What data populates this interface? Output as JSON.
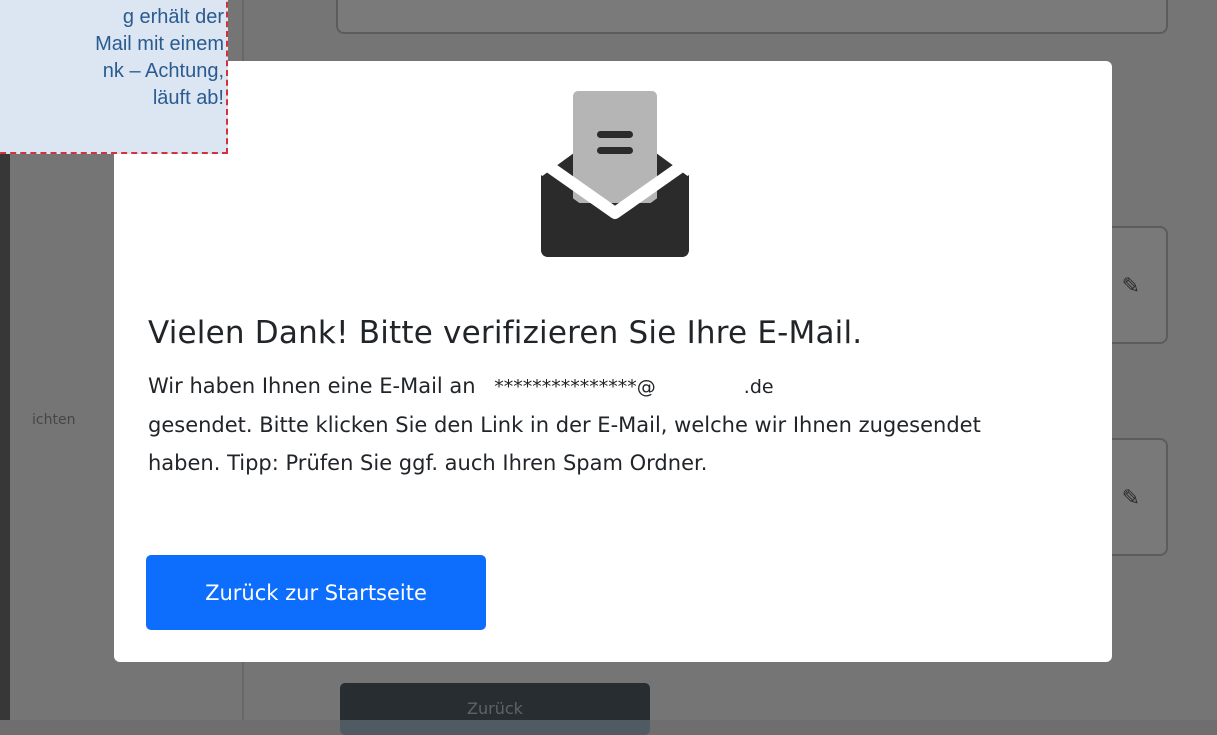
{
  "background": {
    "side_label": "ichten",
    "submit_label": "Zurück"
  },
  "modal": {
    "icon": "open-envelope-icon",
    "title": "Vielen Dank! Bitte verifizieren Sie Ihre E-Mail.",
    "body_prefix": "Wir haben Ihnen eine E-Mail an",
    "email_masked": "***************@",
    "email_domain": ".de",
    "body_suffix": "gesendet. Bitte klicken Sie den Link in der E-Mail, welche wir Ihnen zugesendet haben. Tipp: Prüfen Sie ggf. auch Ihren Spam Ordner.",
    "button_label": "Zurück zur Startseite"
  },
  "callout": {
    "text": "g erhält der\nMail mit einem\nnk – Achtung,\nläuft ab!"
  },
  "colors": {
    "primary": "#0d6efd",
    "callout_bg": "#dbe6f2",
    "callout_border": "#d0333d",
    "callout_text": "#2a5b90"
  }
}
